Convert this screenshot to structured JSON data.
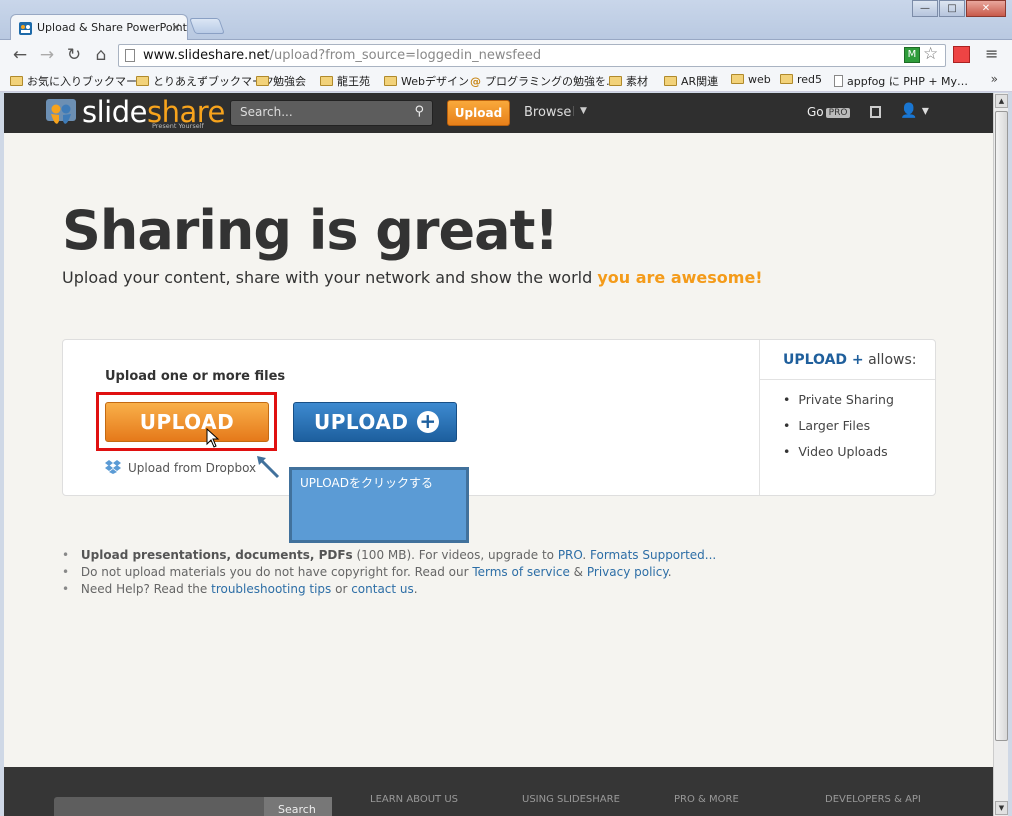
{
  "browser": {
    "tab_title": "Upload & Share PowerPoint",
    "tab_close": "×",
    "url_host": "www.slideshare.net",
    "url_path": "/upload?from_source=loggedin_newsfeed",
    "window_buttons": [
      "—",
      "□",
      "✕"
    ],
    "bookmarks": [
      "お気に入りブックマーク",
      "とりあえずブックマーク",
      "勉強会",
      "龍王苑",
      "Webデザイン",
      "プログラミングの勉強を…",
      "素材",
      "AR関連",
      "web",
      "red5",
      "appfog に PHP + My…"
    ],
    "bookmarks_more": "»"
  },
  "header": {
    "logo_slide": "slide",
    "logo_share": "share",
    "tagline": "Present Yourself",
    "search_placeholder": "Search...",
    "upload_label": "Upload",
    "browse_label": "Browse",
    "go_label": "Go",
    "pro_badge": "PRO"
  },
  "hero": {
    "title": "Sharing is great!",
    "subtitle": "Upload your content, share with your network and show the world ",
    "subtitle_accent": "you are awesome!"
  },
  "upload_card": {
    "heading": "Upload one or more files",
    "upload_button": "UPLOAD",
    "upload_plus_button": "UPLOAD",
    "plus_symbol": "+",
    "dropbox_label": "Upload from Dropbox",
    "side_title_brand": "UPLOAD +",
    "side_title_rest": " allows:",
    "allows": [
      "Private Sharing",
      "Larger Files",
      "Video Uploads"
    ]
  },
  "annotation": {
    "callout_text": "UPLOADをクリックする"
  },
  "notes": {
    "line1_bold": "Upload presentations, documents, PDFs",
    "line1_rest": " (100 MB). For videos, upgrade to ",
    "line1_link1": "PRO",
    "line1_sep": ". ",
    "line1_link2": "Formats Supported...",
    "line2_text": "Do not upload materials you do not have copyright for. Read our ",
    "line2_link1": "Terms of service",
    "line2_sep": " & ",
    "line2_link2": "Privacy policy",
    "line2_end": ".",
    "line3_text": "Need Help? Read the ",
    "line3_link1": "troubleshooting tips",
    "line3_sep": " or ",
    "line3_link2": "contact us",
    "line3_end": "."
  },
  "footer": {
    "search_button": "Search",
    "columns": [
      "LEARN ABOUT US",
      "USING SLIDESHARE",
      "PRO & MORE",
      "DEVELOPERS & API"
    ]
  },
  "colors": {
    "brand_orange": "#f49b1a",
    "brand_blue": "#1d5f9e",
    "highlight_red": "#e01010",
    "callout_blue": "#5b9bd5"
  }
}
